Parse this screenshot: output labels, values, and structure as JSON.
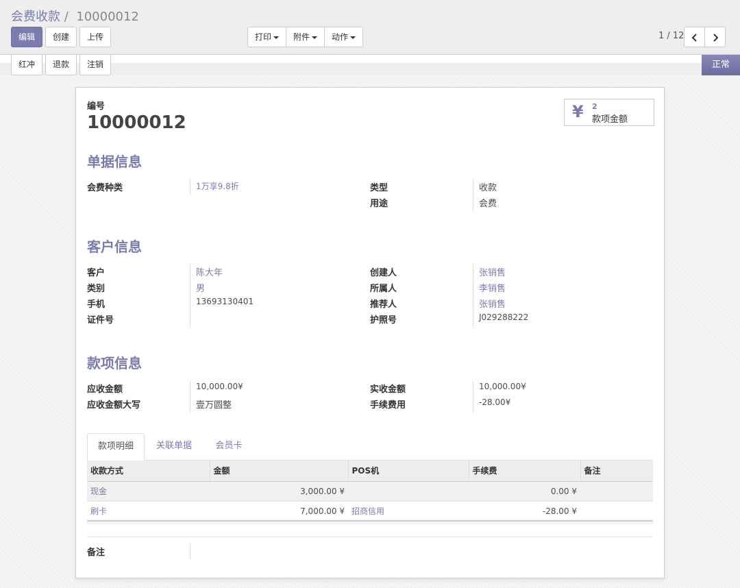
{
  "breadcrumb": {
    "parent": "会费收款",
    "separator": "/",
    "current": "10000012"
  },
  "toolbar": {
    "edit": "编辑",
    "create": "创建",
    "upload": "上传",
    "print": "打印",
    "attachment": "附件",
    "action": "动作"
  },
  "pager": {
    "text": "1 / 12"
  },
  "status_buttons": {
    "reverse": "红冲",
    "refund": "退款",
    "cancel": "注销",
    "state": "正常"
  },
  "record": {
    "number_label": "编号",
    "number": "10000012"
  },
  "stat": {
    "icon": "yen-icon",
    "symbol": "¥",
    "count": "2",
    "label": "款项金额"
  },
  "section_doc": {
    "title": "单据信息",
    "fee_type_label": "会费种类",
    "fee_type": "1万享9.8折",
    "type_label": "类型",
    "type": "收款",
    "purpose_label": "用途",
    "purpose": "会费"
  },
  "section_customer": {
    "title": "客户信息",
    "customer_label": "客户",
    "customer": "陈大年",
    "category_label": "类别",
    "category": "男",
    "phone_label": "手机",
    "phone": "13693130401",
    "id_label": "证件号",
    "id": "",
    "creator_label": "创建人",
    "creator": "张销售",
    "owner_label": "所属人",
    "owner": "李销售",
    "referrer_label": "推荐人",
    "referrer": "张销售",
    "passport_label": "护照号",
    "passport": "J029288222"
  },
  "section_payment": {
    "title": "款项信息",
    "due_label": "应收金额",
    "due": "10,000.00¥",
    "due_words_label": "应收金额大写",
    "due_words": "壹万圆整",
    "received_label": "实收金额",
    "received": "10,000.00¥",
    "fee_label": "手续费用",
    "fee": "-28.00¥"
  },
  "tabs": [
    "款项明细",
    "关联单据",
    "会员卡"
  ],
  "detail_table": {
    "headers": [
      "收款方式",
      "金额",
      "POS机",
      "手续费",
      "备注"
    ],
    "rows": [
      [
        "现金",
        "3,000.00 ¥",
        "",
        "0.00 ¥",
        ""
      ],
      [
        "刷卡",
        "7,000.00 ¥",
        "招商信用",
        "-28.00 ¥",
        ""
      ]
    ]
  },
  "notes": {
    "label": "备注",
    "value": ""
  },
  "colors": {
    "accent": "#7c7bad"
  }
}
